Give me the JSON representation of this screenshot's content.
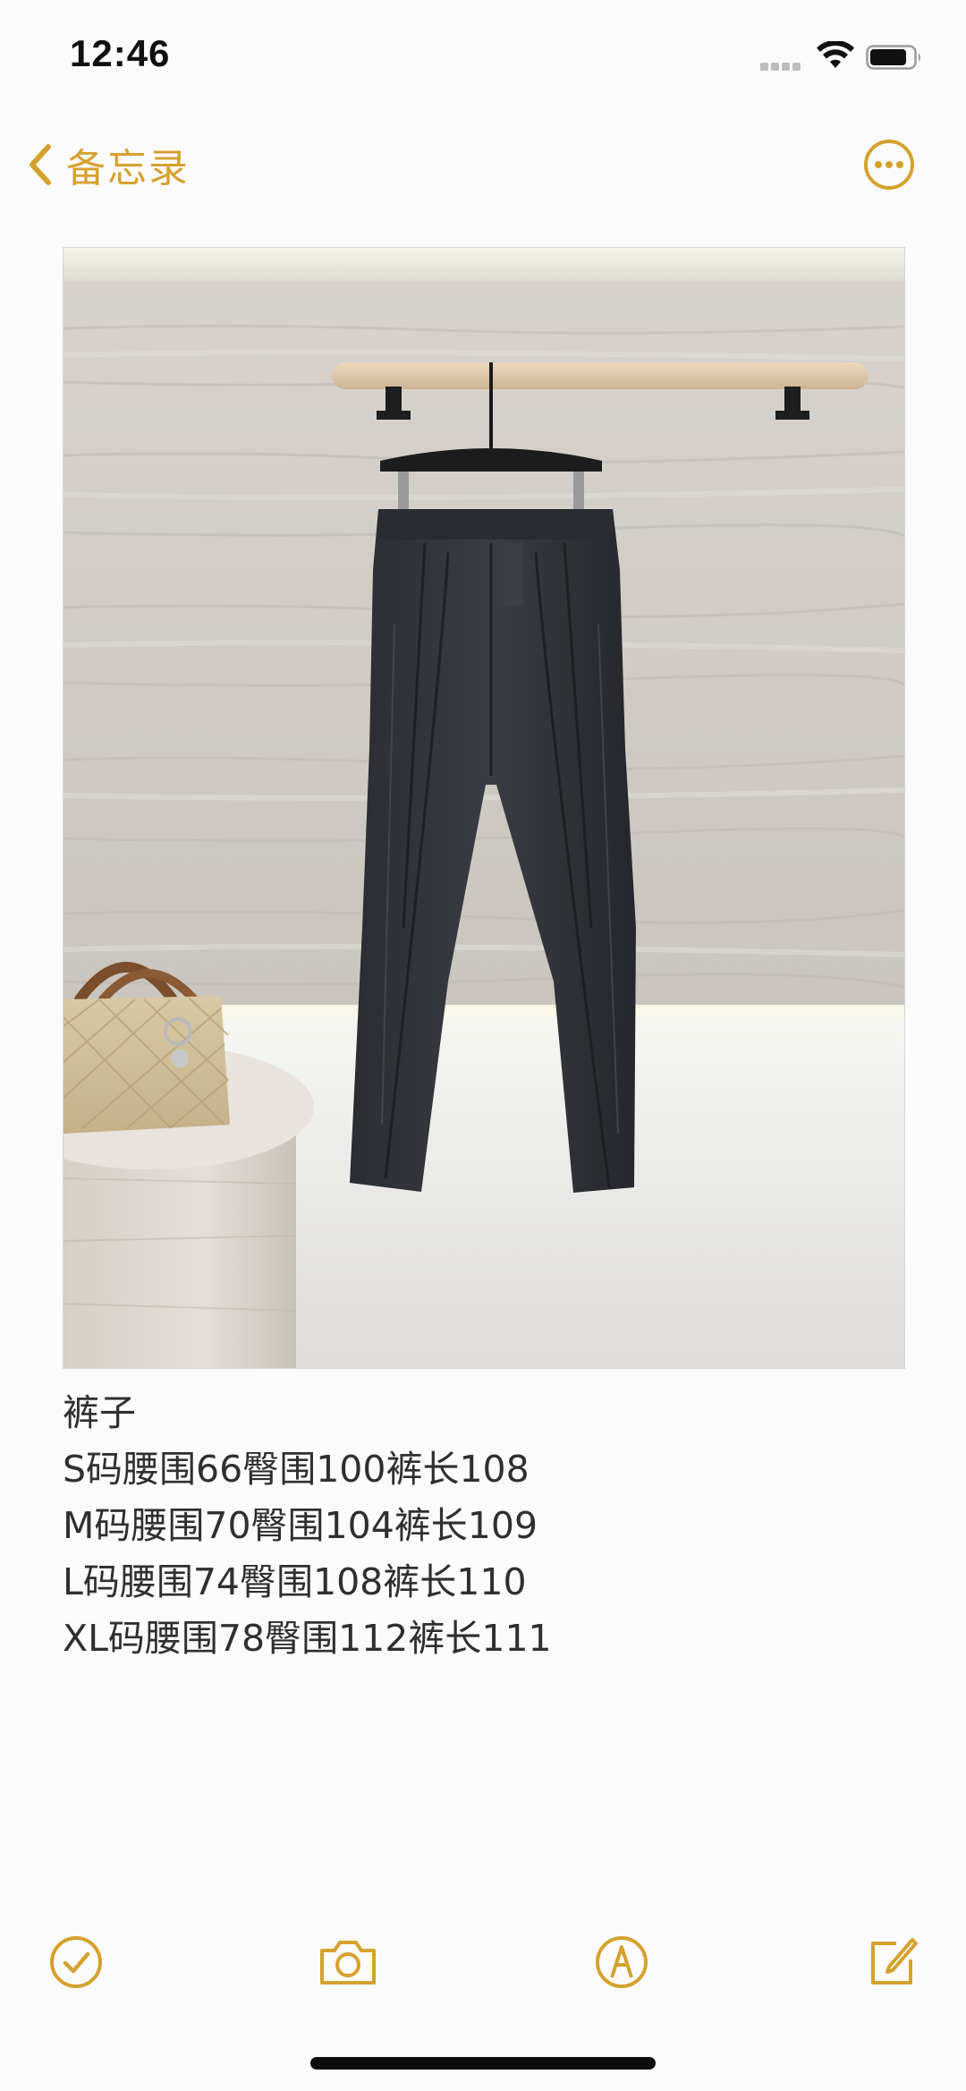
{
  "status_bar": {
    "time": "12:46",
    "icons": [
      "signal-icon",
      "wifi-icon",
      "battery-icon"
    ]
  },
  "nav": {
    "back_label": "备忘录",
    "back_icon": "chevron-left-icon",
    "more_icon": "more-icon"
  },
  "note": {
    "image_alt": "Dark pleated trousers hanging on a wooden rail in front of a travertine wall, with a beige quilted handbag on a stone pedestal",
    "lines": [
      "裤子",
      "S码腰围66臀围100裤长108",
      "M码腰围70臀围104裤长109",
      "L码腰围74臀围108裤长110",
      "XL码腰围78臀围112裤长111"
    ]
  },
  "toolbar": {
    "items": [
      "checklist-icon",
      "camera-icon",
      "markup-icon",
      "compose-icon"
    ]
  },
  "colors": {
    "accent": "#d4a22e",
    "text": "#2f2f2f",
    "background": "#fcfbfc"
  }
}
